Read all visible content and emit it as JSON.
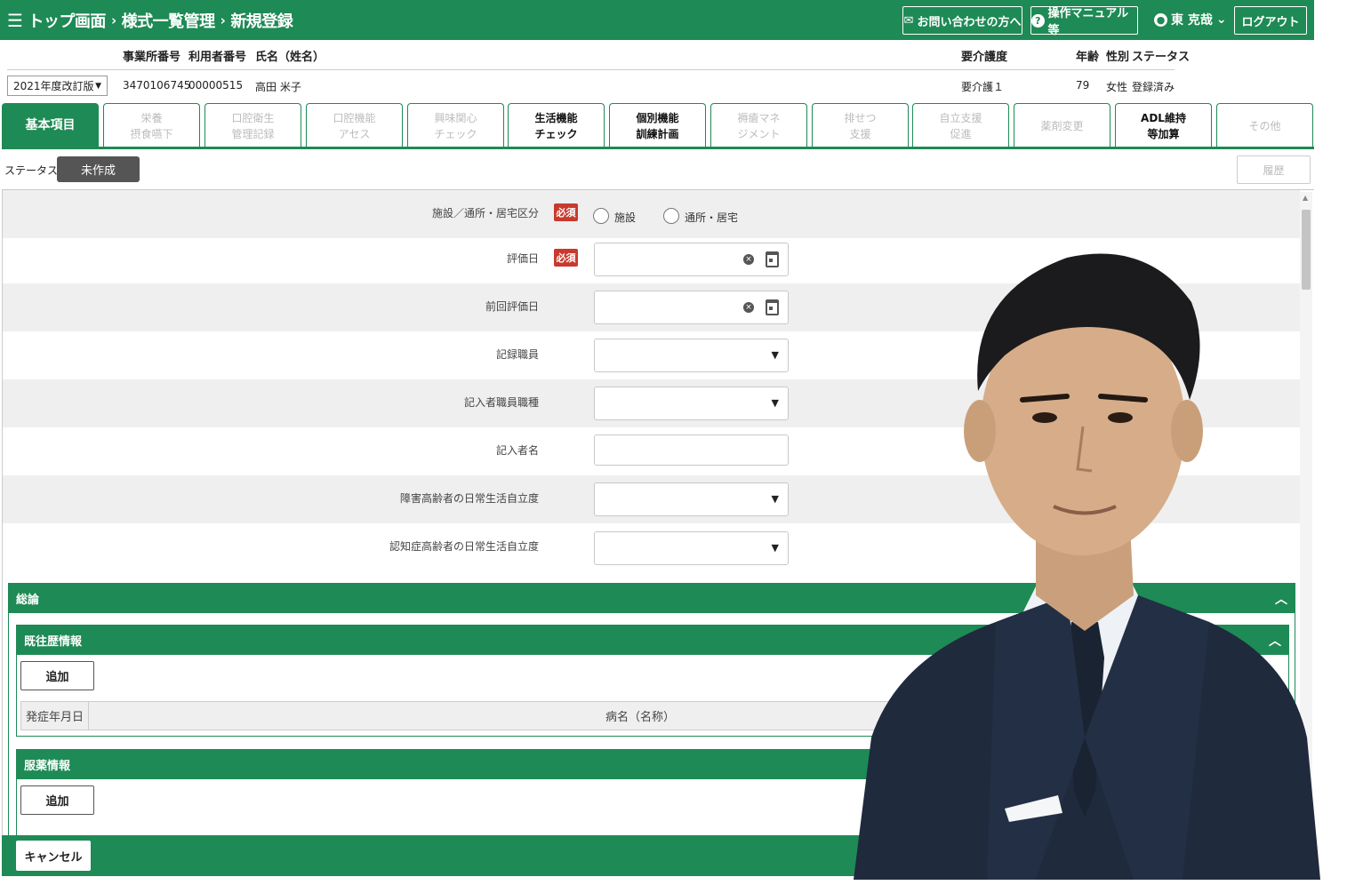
{
  "header": {
    "menu_icon": "hamburger-icon",
    "breadcrumb": [
      "トップ画面",
      "様式一覧管理",
      "新規登録"
    ],
    "breadcrumb_sep": "›",
    "contact_label": "お問い合わせの方へ",
    "manual_label": "操作マニュアル等",
    "user_name": "東 克哉",
    "logout_label": "ログアウト"
  },
  "patient": {
    "version_select": "2021年度改訂版",
    "headers": {
      "office_no": "事業所番号",
      "user_no": "利用者番号",
      "name": "氏名（姓名）",
      "care_level": "要介護度",
      "age": "年齢",
      "sex": "性別",
      "status": "ステータス"
    },
    "values": {
      "office_no": "3470106745",
      "user_no": "00000515",
      "name": "高田 米子",
      "care_level": "要介護１",
      "age": "79",
      "sex": "女性",
      "status": "登録済み"
    }
  },
  "tabs": [
    {
      "label": "基本項目",
      "state": "active"
    },
    {
      "label": "栄養\n摂食嚥下",
      "state": "disabled"
    },
    {
      "label": "口腔衛生\n管理記録",
      "state": "disabled"
    },
    {
      "label": "口腔機能\nアセス",
      "state": "disabled"
    },
    {
      "label": "興味関心\nチェック",
      "state": "disabled"
    },
    {
      "label": "生活機能\nチェック",
      "state": "enabled"
    },
    {
      "label": "個別機能\n訓練計画",
      "state": "enabled"
    },
    {
      "label": "褥瘡マネ\nジメント",
      "state": "disabled"
    },
    {
      "label": "排せつ\n支援",
      "state": "disabled"
    },
    {
      "label": "自立支援\n促進",
      "state": "disabled"
    },
    {
      "label": "薬剤変更",
      "state": "disabled"
    },
    {
      "label": "ADL維持\n等加算",
      "state": "enabled"
    },
    {
      "label": "その他",
      "state": "disabled"
    }
  ],
  "status": {
    "label": "ステータス:",
    "value": "未作成",
    "history_label": "履歴"
  },
  "form": {
    "required_label": "必須",
    "facility_type_label": "施設／通所・居宅区分",
    "facility_options": [
      "施設",
      "通所・居宅"
    ],
    "eval_date_label": "評価日",
    "prev_eval_date_label": "前回評価日",
    "recorder_label": "記録職員",
    "recorder_job_label": "記入者職員職種",
    "recorder_name_label": "記入者名",
    "disabled_elder_label": "障害高齢者の日常生活自立度",
    "dementia_elder_label": "認知症高齢者の日常生活自立度"
  },
  "sections": {
    "general": "総論",
    "medical_history": "既往歴情報",
    "medication": "服薬情報",
    "add_label": "追加",
    "history_columns": [
      "発症年月日",
      "病名（名称）"
    ]
  },
  "footer": {
    "cancel_label": "キャンセル"
  }
}
